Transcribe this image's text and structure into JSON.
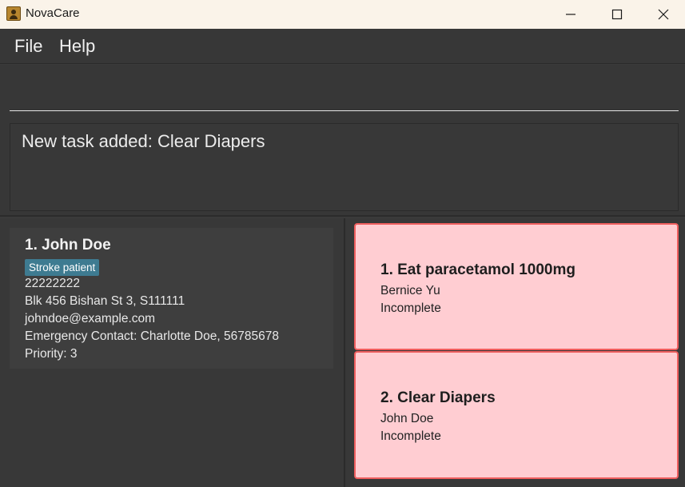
{
  "window": {
    "title": "NovaCare",
    "icon": "app-icon",
    "controls": [
      "minimize-icon",
      "maximize-icon",
      "close-icon"
    ]
  },
  "menu": {
    "file_label": "File",
    "help_label": "Help"
  },
  "command": {
    "value": "",
    "placeholder": ""
  },
  "result": {
    "message": "New task added: Clear Diapers"
  },
  "persons": [
    {
      "name": "1. John Doe",
      "tag": "Stroke patient",
      "phone": "22222222",
      "address": "Blk 456 Bishan St 3, S111111",
      "email": "johndoe@example.com",
      "emergency_contact": "Emergency Contact: Charlotte Doe, 56785678",
      "priority": "Priority: 3"
    }
  ],
  "tasks": [
    {
      "title": "1. Eat paracetamol 1000mg",
      "person": "Bernice Yu",
      "status": "Incomplete"
    },
    {
      "title": "2. Clear Diapers",
      "person": "John Doe",
      "status": "Incomplete"
    }
  ],
  "colors": {
    "background": "#3a3a3a",
    "tag": "#3e7b91",
    "task_card": "#ffcdd2",
    "task_border": "#ef5e5e"
  }
}
